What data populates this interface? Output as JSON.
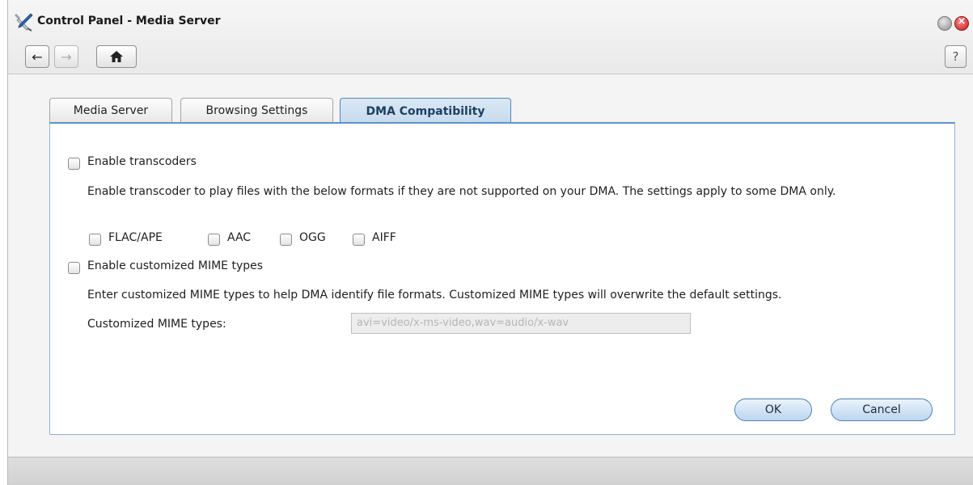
{
  "window": {
    "title": "Control Panel - Media Server"
  },
  "toolbar": {
    "back_icon": "arrow-left-icon",
    "forward_icon": "arrow-right-icon",
    "home_icon": "home-icon",
    "help_label": "?"
  },
  "tabs": [
    {
      "label": "Media Server",
      "active": false
    },
    {
      "label": "Browsing Settings",
      "active": false
    },
    {
      "label": "DMA Compatibility",
      "active": true
    }
  ],
  "transcoders": {
    "enable_label": "Enable transcoders",
    "checked": false,
    "description": "Enable transcoder to play files with the below formats if they are not supported on your DMA. The settings apply to some DMA only.",
    "formats": [
      {
        "label": "FLAC/APE",
        "checked": false
      },
      {
        "label": "AAC",
        "checked": false
      },
      {
        "label": "OGG",
        "checked": false
      },
      {
        "label": "AIFF",
        "checked": false
      }
    ]
  },
  "mime": {
    "enable_label": "Enable customized MIME types",
    "checked": false,
    "description": "Enter customized MIME types to help DMA identify file formats. Customized MIME types will overwrite the default settings.",
    "field_label": "Customized MIME types:",
    "value": "",
    "placeholder": "avi=video/x-ms-video,wav=audio/x-wav"
  },
  "buttons": {
    "ok_label": "OK",
    "cancel_label": "Cancel"
  },
  "colors": {
    "accent": "#5c93c8",
    "close_button": "#c4171b"
  }
}
